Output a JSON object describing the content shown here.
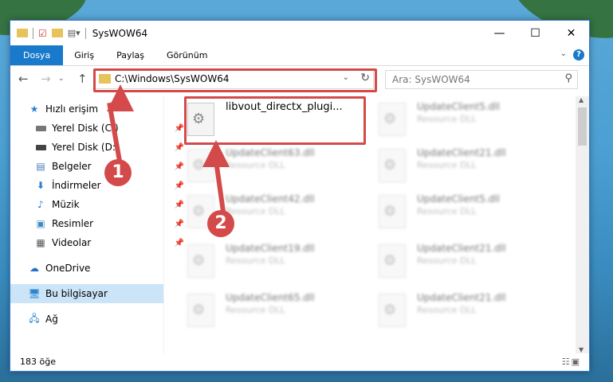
{
  "window": {
    "title": "SysWOW64"
  },
  "ribbon": {
    "tabs": [
      "Dosya",
      "Giriş",
      "Paylaş",
      "Görünüm"
    ]
  },
  "address": {
    "path": "C:\\Windows\\SysWOW64"
  },
  "search": {
    "placeholder": "Ara: SysWOW64"
  },
  "sidebar": {
    "items": [
      {
        "label": "Hızlı erişim",
        "icon": "star-icon"
      },
      {
        "label": "Yerel Disk (C:)",
        "icon": "drive-icon",
        "pinned": true
      },
      {
        "label": "Yerel Disk (D:)",
        "icon": "drive-icon",
        "pinned": true
      },
      {
        "label": "Belgeler",
        "icon": "documents-icon",
        "pinned": true
      },
      {
        "label": "İndirmeler",
        "icon": "download-icon",
        "pinned": true
      },
      {
        "label": "Müzik",
        "icon": "music-icon",
        "pinned": true
      },
      {
        "label": "Resimler",
        "icon": "pictures-icon",
        "pinned": true
      },
      {
        "label": "Videolar",
        "icon": "videos-icon",
        "pinned": true
      },
      {
        "label": "OneDrive",
        "icon": "cloud-icon"
      },
      {
        "label": "Bu bilgisayar",
        "icon": "computer-icon",
        "selected": true
      },
      {
        "label": "Ağ",
        "icon": "network-icon"
      }
    ]
  },
  "files": {
    "highlighted": {
      "name": "libvout_directx_plugi..."
    },
    "items": [
      {
        "name": "UpdateClient5.dll",
        "type": "Resource DLL"
      },
      {
        "name": "UpdateClient63.dll",
        "type": "Resource DLL"
      },
      {
        "name": "UpdateClient21.dll",
        "type": "Resource DLL"
      },
      {
        "name": "UpdateClient42.dll",
        "type": "Resource DLL"
      },
      {
        "name": "UpdateClient5.dll",
        "type": "Resource DLL"
      },
      {
        "name": "UpdateClient19.dll",
        "type": "Resource DLL"
      },
      {
        "name": "UpdateClient21.dll",
        "type": "Resource DLL"
      },
      {
        "name": "UpdateClient65.dll",
        "type": "Resource DLL"
      },
      {
        "name": "UpdateClient21.dll",
        "type": "Resource DLL"
      }
    ]
  },
  "status": {
    "count": "183 öğe"
  },
  "annotations": {
    "step1": "1",
    "step2": "2",
    "color": "#d44a4a"
  }
}
